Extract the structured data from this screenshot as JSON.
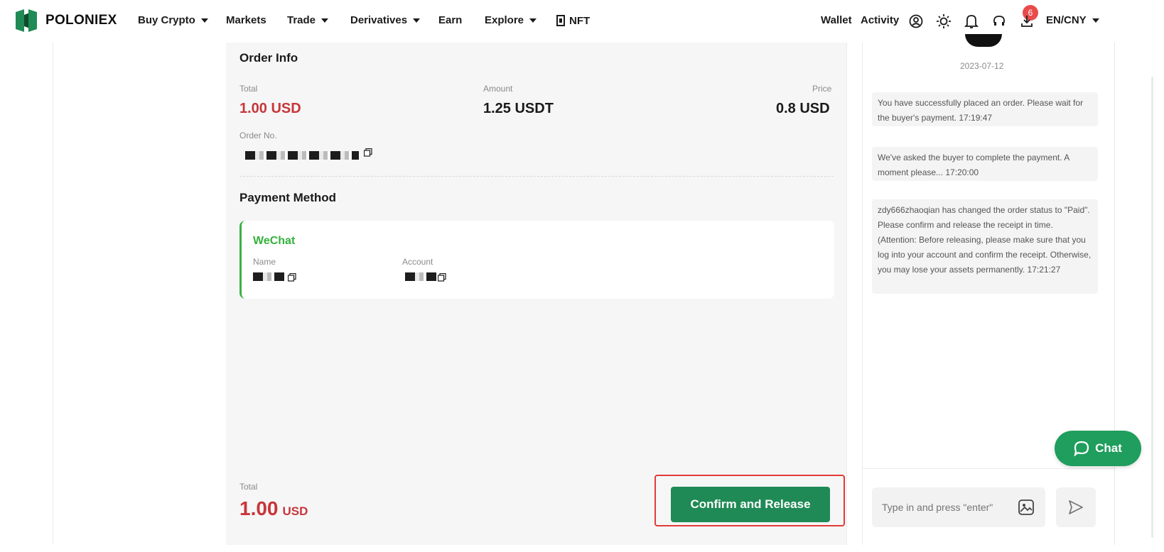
{
  "brand": {
    "name": "POLONIEX",
    "accent": "#1f8a55"
  },
  "nav": {
    "items": [
      {
        "label": "Buy Crypto",
        "dropdown": true
      },
      {
        "label": "Markets",
        "dropdown": false
      },
      {
        "label": "Trade",
        "dropdown": true
      },
      {
        "label": "Derivatives",
        "dropdown": true
      },
      {
        "label": "Earn",
        "dropdown": false
      },
      {
        "label": "Explore",
        "dropdown": true
      },
      {
        "label": "NFT",
        "dropdown": false
      }
    ],
    "right": {
      "wallet": "Wallet",
      "activity": "Activity",
      "notification_count": "6",
      "language": "EN/CNY",
      "icons": [
        "user-icon",
        "sun-icon",
        "bell-icon",
        "headset-icon",
        "download-icon"
      ]
    }
  },
  "order_info": {
    "title": "Order Info",
    "total_label": "Total",
    "total_value": "1.00 USD",
    "amount_label": "Amount",
    "amount_value": "1.25 USDT",
    "price_label": "Price",
    "price_value": "0.8 USD",
    "order_no_label": "Order No."
  },
  "payment": {
    "title": "Payment Method",
    "method": "WeChat",
    "name_label": "Name",
    "account_label": "Account"
  },
  "footer": {
    "total_label": "Total",
    "total_amount": "1.00",
    "total_unit": "USD",
    "confirm_button": "Confirm and Release"
  },
  "chat": {
    "date": "2023-07-12",
    "messages": [
      "You have successfully placed an order. Please wait for the buyer's payment. 17:19:47",
      "We've asked the buyer to complete the payment. A moment please... 17:20:00",
      "zdy666zhaoqian has changed the order status to \"Paid\". Please confirm and release the receipt in time. (Attention: Before releasing, please make sure that you log into your account and confirm the receipt. Otherwise, you may lose your assets permanently. 17:21:27"
    ],
    "input_placeholder": "Type in and press \"enter\"",
    "fab_label": "Chat"
  }
}
